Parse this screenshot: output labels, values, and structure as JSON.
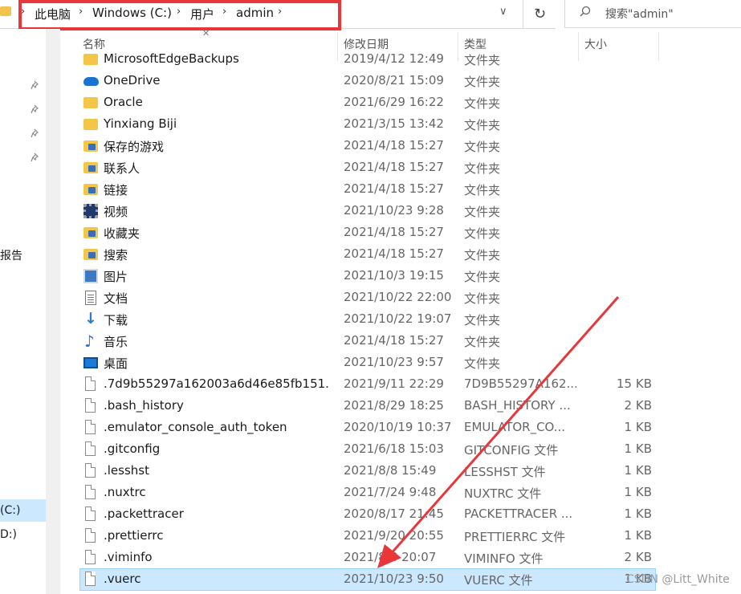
{
  "address_bar": {
    "crumbs": [
      "此电脑",
      "Windows (C:)",
      "用户",
      "admin"
    ],
    "chevron": "›",
    "dropdown": "∨",
    "refresh": "↻"
  },
  "search": {
    "placeholder": "搜索\"admin\""
  },
  "nav_pane": {
    "items": [
      "报告",
      "(C:)",
      "D:)"
    ]
  },
  "columns": {
    "name": "名称",
    "date": "修改日期",
    "type": "类型",
    "size": "大小"
  },
  "rows": [
    {
      "name": "MicrosoftEdgeBackups",
      "date": "2019/4/12 12:49",
      "type": "文件夹",
      "size": "",
      "icon": "folder-icon"
    },
    {
      "name": "OneDrive",
      "date": "2020/8/21 15:09",
      "type": "文件夹",
      "size": "",
      "icon": "onedrive-icon"
    },
    {
      "name": "Oracle",
      "date": "2021/6/29 16:22",
      "type": "文件夹",
      "size": "",
      "icon": "folder-icon"
    },
    {
      "name": "Yinxiang Biji",
      "date": "2021/3/15 13:42",
      "type": "文件夹",
      "size": "",
      "icon": "folder-icon"
    },
    {
      "name": "保存的游戏",
      "date": "2021/4/18 15:27",
      "type": "文件夹",
      "size": "",
      "icon": "saved-games-icon"
    },
    {
      "name": "联系人",
      "date": "2021/4/18 15:27",
      "type": "文件夹",
      "size": "",
      "icon": "contacts-icon"
    },
    {
      "name": "链接",
      "date": "2021/4/18 15:27",
      "type": "文件夹",
      "size": "",
      "icon": "links-icon"
    },
    {
      "name": "视频",
      "date": "2021/10/23 9:28",
      "type": "文件夹",
      "size": "",
      "icon": "video-icon"
    },
    {
      "name": "收藏夹",
      "date": "2021/4/18 15:27",
      "type": "文件夹",
      "size": "",
      "icon": "favorites-icon"
    },
    {
      "name": "搜索",
      "date": "2021/4/18 15:27",
      "type": "文件夹",
      "size": "",
      "icon": "searches-icon"
    },
    {
      "name": "图片",
      "date": "2021/10/3 19:15",
      "type": "文件夹",
      "size": "",
      "icon": "pictures-icon"
    },
    {
      "name": "文档",
      "date": "2021/10/22 22:00",
      "type": "文件夹",
      "size": "",
      "icon": "documents-icon"
    },
    {
      "name": "下载",
      "date": "2021/10/22 19:07",
      "type": "文件夹",
      "size": "",
      "icon": "downloads-icon"
    },
    {
      "name": "音乐",
      "date": "2021/4/18 15:27",
      "type": "文件夹",
      "size": "",
      "icon": "music-icon"
    },
    {
      "name": "桌面",
      "date": "2021/10/23 9:57",
      "type": "文件夹",
      "size": "",
      "icon": "desktop-icon"
    },
    {
      "name": ".7d9b55297a162003a6d46e85fb151...",
      "date": "2021/9/11 22:29",
      "type": "7D9B55297A162...",
      "size": "15 KB",
      "icon": "file-icon"
    },
    {
      "name": ".bash_history",
      "date": "2021/8/29 18:25",
      "type": "BASH_HISTORY ...",
      "size": "2 KB",
      "icon": "file-icon"
    },
    {
      "name": ".emulator_console_auth_token",
      "date": "2020/10/19 10:37",
      "type": "EMULATOR_CO...",
      "size": "1 KB",
      "icon": "file-icon"
    },
    {
      "name": ".gitconfig",
      "date": "2021/6/18 15:03",
      "type": "GITCONFIG 文件",
      "size": "1 KB",
      "icon": "file-icon"
    },
    {
      "name": ".lesshst",
      "date": "2021/8/8 15:49",
      "type": "LESSHST 文件",
      "size": "1 KB",
      "icon": "file-icon"
    },
    {
      "name": ".nuxtrc",
      "date": "2021/7/24 9:48",
      "type": "NUXTRC 文件",
      "size": "1 KB",
      "icon": "file-icon"
    },
    {
      "name": ".packettracer",
      "date": "2020/8/17 21:45",
      "type": "PACKETTRACER ...",
      "size": "1 KB",
      "icon": "file-icon"
    },
    {
      "name": ".prettierrc",
      "date": "2021/9/20 20:55",
      "type": "PRETTIERRC 文件",
      "size": "1 KB",
      "icon": "file-icon"
    },
    {
      "name": ".viminfo",
      "date": "2021/8/8 20:07",
      "type": "VIMINFO 文件",
      "size": "2 KB",
      "icon": "file-icon"
    },
    {
      "name": ".vuerc",
      "date": "2021/10/23 9:50",
      "type": "VUERC 文件",
      "size": "1 KB",
      "icon": "file-icon",
      "selected": true
    }
  ],
  "watermark": "CSDN @Litt_White",
  "colors": {
    "highlight_box": "#e8363b",
    "arrow": "#e8363b",
    "selection": "#cce8ff"
  }
}
